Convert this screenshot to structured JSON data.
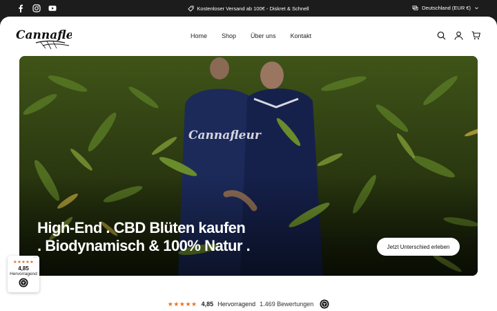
{
  "topbar": {
    "social_icons": [
      "facebook-icon",
      "instagram-icon",
      "youtube-icon"
    ],
    "announcement": "Kostenloser Versand ab 100€ - Diskret & Schnell",
    "locale": "Deutschland (EUR €)"
  },
  "header": {
    "logo_text": "Cannafleur",
    "nav": [
      {
        "label": "Home"
      },
      {
        "label": "Shop"
      },
      {
        "label": "Über uns"
      },
      {
        "label": "Kontakt"
      }
    ],
    "icons": [
      "search-icon",
      "account-icon",
      "cart-icon"
    ]
  },
  "hero": {
    "title_line1": "High-End . CBD Blüten kaufen",
    "title_line2": ". Biodynamisch & 100% Natur .",
    "cta_label": "Jetzt Unterschied erleben"
  },
  "review_badge": {
    "stars": "★★★★★",
    "score": "4,85",
    "label": "Hervorragend"
  },
  "rating_bar": {
    "stars": "★★★★★",
    "score": "4,85",
    "label": "Hervorragend",
    "count": "1.469 Bewertungen"
  },
  "colors": {
    "topbar_bg": "#1c1c1c",
    "star_orange": "#e8731f",
    "foliage": "#4e6a1e"
  }
}
